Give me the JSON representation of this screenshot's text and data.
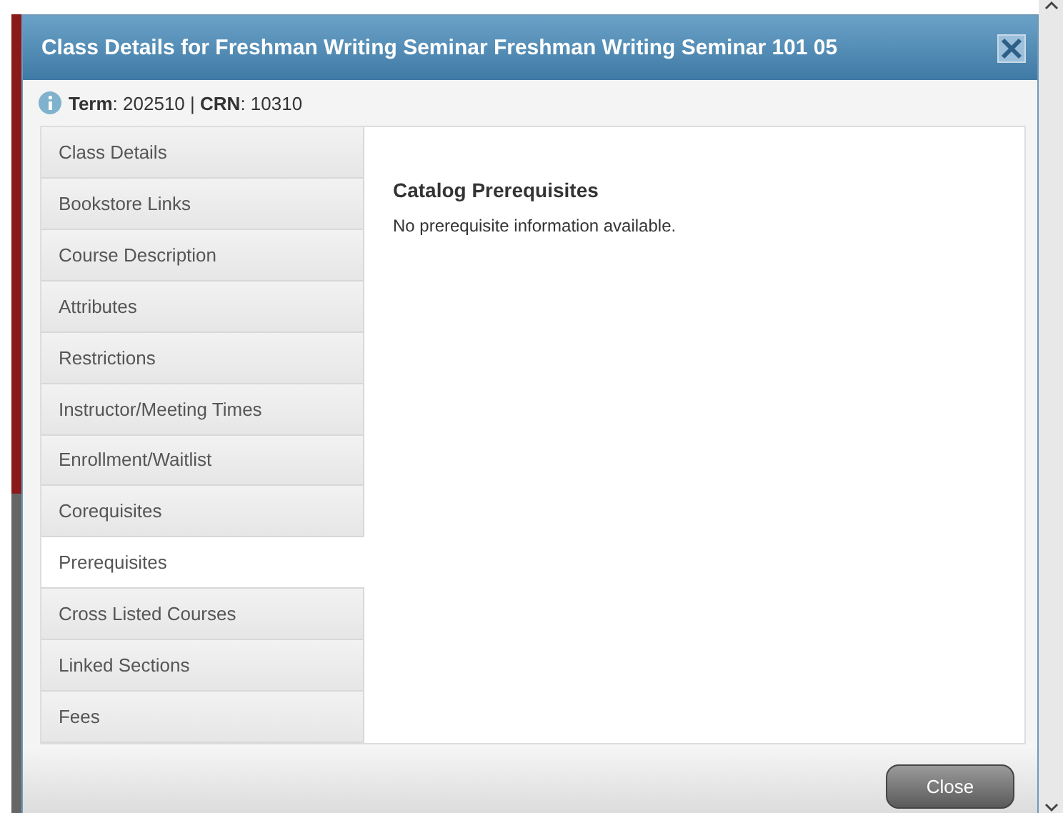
{
  "dialog": {
    "title": "Class Details for Freshman Writing Seminar Freshman Writing Seminar 101 05"
  },
  "info": {
    "term_label": "Term",
    "term_value": ": 202510 | ",
    "crn_label": "CRN",
    "crn_value": ": 10310"
  },
  "tabs": [
    {
      "label": "Class Details",
      "selected": false
    },
    {
      "label": "Bookstore Links",
      "selected": false
    },
    {
      "label": "Course Description",
      "selected": false
    },
    {
      "label": "Attributes",
      "selected": false
    },
    {
      "label": "Restrictions",
      "selected": false
    },
    {
      "label": "Instructor/Meeting Times",
      "selected": false
    },
    {
      "label": "Enrollment/Waitlist",
      "selected": false
    },
    {
      "label": "Corequisites",
      "selected": false
    },
    {
      "label": "Prerequisites",
      "selected": true
    },
    {
      "label": "Cross Listed Courses",
      "selected": false
    },
    {
      "label": "Linked Sections",
      "selected": false
    },
    {
      "label": "Fees",
      "selected": false
    }
  ],
  "panel": {
    "heading": "Catalog Prerequisites",
    "message": "No prerequisite information available."
  },
  "buttons": [
    "Close"
  ]
}
